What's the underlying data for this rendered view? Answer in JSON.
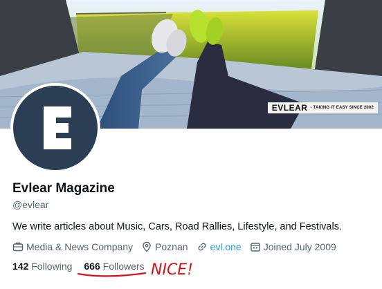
{
  "banner": {
    "brand": "EVLEAR",
    "slogan": "- TAKING IT EASY SINCE 2002"
  },
  "avatar": {
    "letter": "E",
    "color": "#2c3e53"
  },
  "profile": {
    "name": "Evlear Magazine",
    "handle": "@evlear",
    "bio": "We write articles about Music, Cars, Road Rallies, Lifestyle, and Festivals."
  },
  "meta": {
    "category": "Media & News Company",
    "location": "Poznan",
    "website": "evl.one",
    "joined": "Joined July 2009"
  },
  "stats": {
    "following_count": "142",
    "following_label": "Following",
    "followers_count": "666",
    "followers_label": "Followers"
  },
  "annotation": {
    "text": "NICE!",
    "color": "#d4141b"
  },
  "colors": {
    "link": "#1d9bf0",
    "muted": "#536471",
    "text": "#0f1419"
  }
}
